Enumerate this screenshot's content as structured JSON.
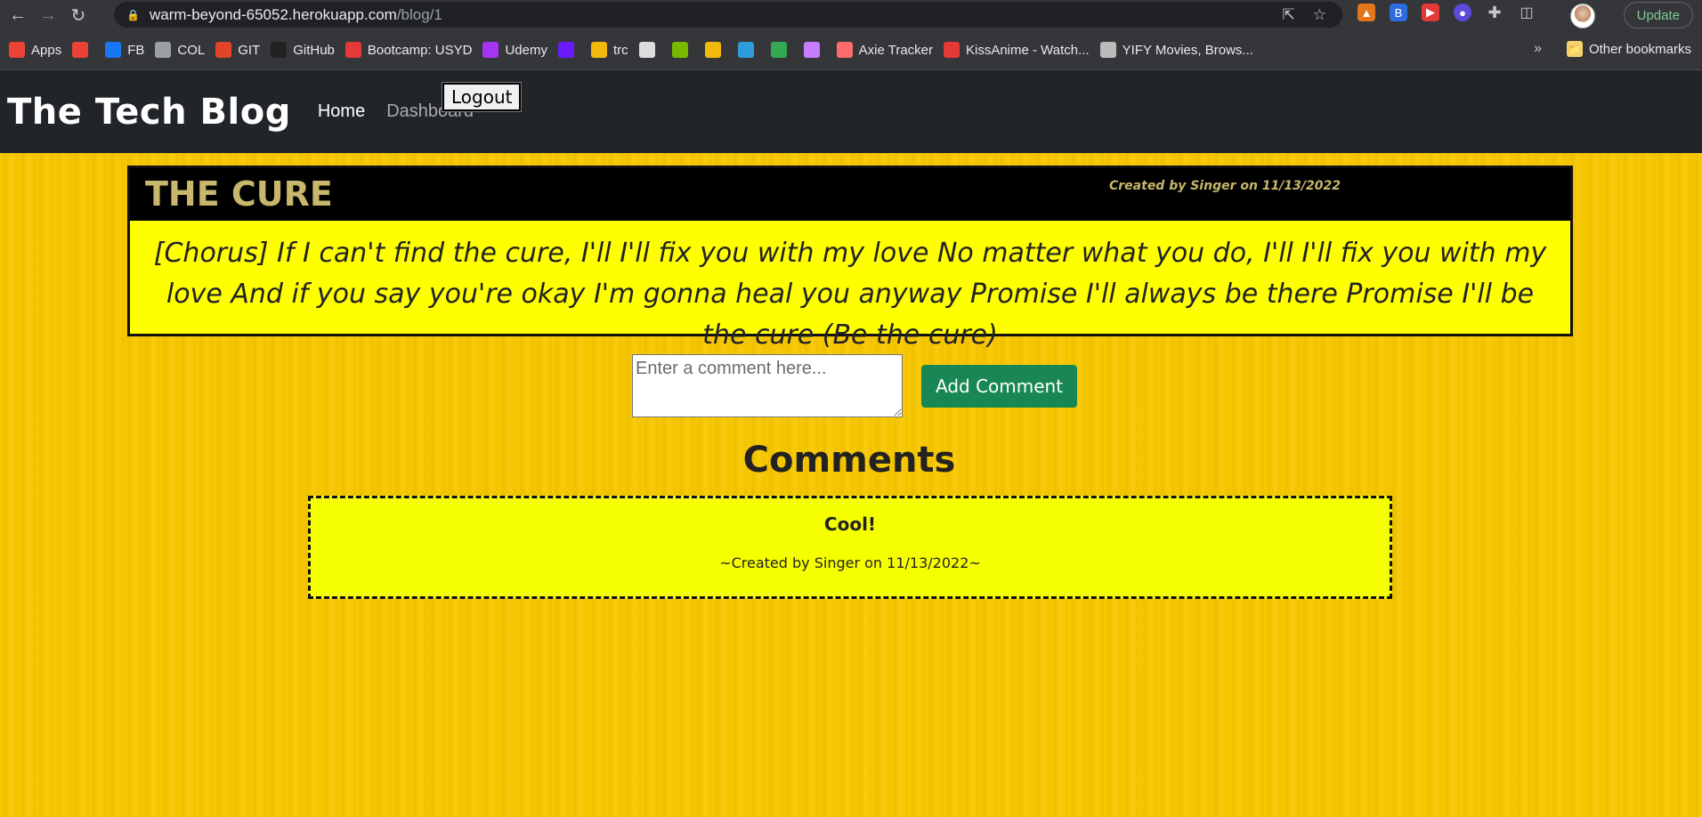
{
  "browser": {
    "url_host": "warm-beyond-65052.herokuapp.com",
    "url_path": "/blog/1",
    "update_label": "Update",
    "bookmarks": [
      {
        "label": "Apps",
        "icon": "apps-grid-icon",
        "color": "#ea4335"
      },
      {
        "label": "",
        "icon": "gmail-icon",
        "color": "#ea4335"
      },
      {
        "label": "FB",
        "icon": "facebook-icon",
        "color": "#1877f2"
      },
      {
        "label": "COL",
        "icon": "col-icon",
        "color": "#9aa0a6"
      },
      {
        "label": "GIT",
        "icon": "gitlab-icon",
        "color": "#e24329"
      },
      {
        "label": "GitHub",
        "icon": "github-icon",
        "color": "#222"
      },
      {
        "label": "Bootcamp: USYD",
        "icon": "bootcamp-icon",
        "color": "#e53935"
      },
      {
        "label": "Udemy",
        "icon": "udemy-icon",
        "color": "#a435f0"
      },
      {
        "label": "",
        "icon": "mail-icon",
        "color": "#6a1bff"
      },
      {
        "label": "trc",
        "icon": "trc-icon",
        "color": "#f0b90b"
      },
      {
        "label": "",
        "icon": "terminal-icon",
        "color": "#ddd"
      },
      {
        "label": "",
        "icon": "nvidia-icon",
        "color": "#76b900"
      },
      {
        "label": "",
        "icon": "binance-icon",
        "color": "#f0b90b"
      },
      {
        "label": "",
        "icon": "vscode-icon",
        "color": "#2d9cdb"
      },
      {
        "label": "",
        "icon": "maps-icon",
        "color": "#34a853"
      },
      {
        "label": "",
        "icon": "axie-icon",
        "color": "#c77dff"
      },
      {
        "label": "Axie Tracker",
        "icon": "axie-tracker-icon",
        "color": "#ff6b6b"
      },
      {
        "label": "KissAnime - Watch...",
        "icon": "kissanime-icon",
        "color": "#e53935"
      },
      {
        "label": "YIFY Movies, Brows...",
        "icon": "yify-icon",
        "color": "#bbbbbb"
      }
    ],
    "other_bookmarks_label": "Other bookmarks"
  },
  "site": {
    "brand": "The Tech Blog",
    "nav": {
      "home": "Home",
      "dashboard": "Dashboard",
      "logout": "Logout"
    }
  },
  "post": {
    "title": "THE CURE",
    "meta": "Created by Singer on 11/13/2022",
    "body": "[Chorus] If I can't find the cure, I'll I'll fix you with my love No matter what you do, I'll I'll fix you with my love And if you say you're okay I'm gonna heal you anyway Promise I'll always be there Promise I'll be the cure (Be the cure)"
  },
  "comment_form": {
    "placeholder": "Enter a comment here...",
    "submit_label": "Add Comment"
  },
  "comments": {
    "heading": "Comments",
    "items": [
      {
        "text": "Cool!",
        "meta": "~Created by Singer on 11/13/2022~"
      }
    ]
  },
  "colors": {
    "background": "#f9c800",
    "navbar": "#212529",
    "post_header": "#000000",
    "post_title": "#c7b66b",
    "post_body_bg": "#ffff00",
    "add_button": "#198754"
  }
}
